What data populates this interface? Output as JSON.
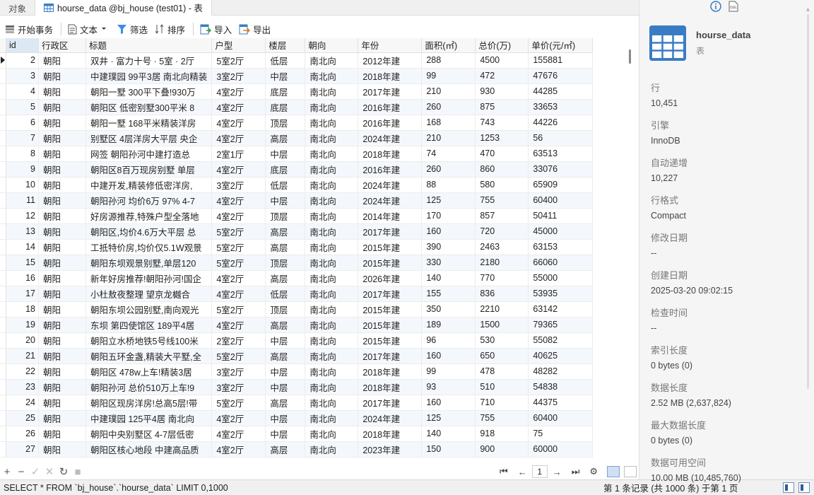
{
  "tabs": [
    {
      "label": "对象",
      "active": false
    },
    {
      "label": "hourse_data @bj_house (test01) - 表",
      "active": true
    }
  ],
  "toolbar": {
    "begin_transaction": "开始事务",
    "text": "文本",
    "filter": "筛选",
    "sort": "排序",
    "import": "导入",
    "export": "导出"
  },
  "table": {
    "columns": [
      "id",
      "行政区",
      "标题",
      "户型",
      "楼层",
      "朝向",
      "年份",
      "面积(㎡)",
      "总价(万)",
      "单价(元/㎡)"
    ],
    "rows": [
      [
        "2",
        "朝阳",
        "双井 · 富力十号 · 5室 · 2厅",
        "5室2厅",
        "低层",
        "南北向",
        "2012年建",
        "288",
        "4500",
        "155881"
      ],
      [
        "3",
        "朝阳",
        "中建璞园 99平3居 南北向精装",
        "3室2厅",
        "中层",
        "南北向",
        "2018年建",
        "99",
        "472",
        "47676"
      ],
      [
        "4",
        "朝阳",
        "朝阳一墅 300平下叠!930万",
        "4室2厅",
        "底层",
        "南北向",
        "2017年建",
        "210",
        "930",
        "44285"
      ],
      [
        "5",
        "朝阳",
        "朝阳区 低密别墅300平米 8",
        "4室2厅",
        "底层",
        "南北向",
        "2016年建",
        "260",
        "875",
        "33653"
      ],
      [
        "6",
        "朝阳",
        "朝阳一墅 168平米精装洋房",
        "4室2厅",
        "顶层",
        "南北向",
        "2016年建",
        "168",
        "743",
        "44226"
      ],
      [
        "7",
        "朝阳",
        "别墅区 4层洋房大平层 央企",
        "4室2厅",
        "高层",
        "南北向",
        "2024年建",
        "210",
        "1253",
        "56"
      ],
      [
        "8",
        "朝阳",
        "网签 朝阳孙河中建打造总",
        "2室1厅",
        "中层",
        "南北向",
        "2018年建",
        "74",
        "470",
        "63513"
      ],
      [
        "9",
        "朝阳",
        "朝阳区8百万现房别墅 单层",
        "4室2厅",
        "底层",
        "南北向",
        "2016年建",
        "260",
        "860",
        "33076"
      ],
      [
        "10",
        "朝阳",
        "中建开发,精装修低密洋房,",
        "3室2厅",
        "低层",
        "南北向",
        "2024年建",
        "88",
        "580",
        "65909"
      ],
      [
        "11",
        "朝阳",
        "朝阳孙河 均价6万 97% 4-7",
        "4室2厅",
        "中层",
        "南北向",
        "2024年建",
        "125",
        "755",
        "60400"
      ],
      [
        "12",
        "朝阳",
        "好房源推荐,特殊户型全落地",
        "4室2厅",
        "顶层",
        "南北向",
        "2014年建",
        "170",
        "857",
        "50411"
      ],
      [
        "13",
        "朝阳",
        "朝阳区,均价4.6万大平层 总",
        "5室2厅",
        "高层",
        "南北向",
        "2017年建",
        "160",
        "720",
        "45000"
      ],
      [
        "14",
        "朝阳",
        "工抵特价房,均价仅5.1W观景",
        "5室2厅",
        "高层",
        "南北向",
        "2015年建",
        "390",
        "2463",
        "63153"
      ],
      [
        "15",
        "朝阳",
        "朝阳东坝观景别墅,单层120",
        "5室2厅",
        "顶层",
        "南北向",
        "2015年建",
        "330",
        "2180",
        "66060"
      ],
      [
        "16",
        "朝阳",
        "新年好房推荐!朝阳孙河!国企",
        "4室2厅",
        "高层",
        "南北向",
        "2026年建",
        "140",
        "770",
        "55000"
      ],
      [
        "17",
        "朝阳",
        "小杜敖夜整理 望京龙樾合",
        "4室2厅",
        "低层",
        "南北向",
        "2017年建",
        "155",
        "836",
        "53935"
      ],
      [
        "18",
        "朝阳",
        "朝阳东坝公园别墅,南向观光",
        "5室2厅",
        "顶层",
        "南北向",
        "2015年建",
        "350",
        "2210",
        "63142"
      ],
      [
        "19",
        "朝阳",
        "东坝 第四使馆区 189平4居",
        "4室2厅",
        "高层",
        "南北向",
        "2015年建",
        "189",
        "1500",
        "79365"
      ],
      [
        "20",
        "朝阳",
        "朝阳立水桥地铁5号线100米",
        "2室2厅",
        "中层",
        "南北向",
        "2015年建",
        "96",
        "530",
        "55082"
      ],
      [
        "21",
        "朝阳",
        "朝阳五环金盏,精装大平墅,全",
        "5室2厅",
        "高层",
        "南北向",
        "2017年建",
        "160",
        "650",
        "40625"
      ],
      [
        "22",
        "朝阳",
        "朝阳区 478w上车!精装3居",
        "3室2厅",
        "中层",
        "南北向",
        "2018年建",
        "99",
        "478",
        "48282"
      ],
      [
        "23",
        "朝阳",
        "朝阳孙河 总价510万上车!9",
        "3室2厅",
        "中层",
        "南北向",
        "2018年建",
        "93",
        "510",
        "54838"
      ],
      [
        "24",
        "朝阳",
        "朝阳区现房洋房!总高5层!带",
        "5室2厅",
        "高层",
        "南北向",
        "2017年建",
        "160",
        "710",
        "44375"
      ],
      [
        "25",
        "朝阳",
        "中建璞园 125平4居 南北向",
        "4室2厅",
        "中层",
        "南北向",
        "2024年建",
        "125",
        "755",
        "60400"
      ],
      [
        "26",
        "朝阳",
        "朝阳中央别墅区 4-7层低密",
        "4室2厅",
        "中层",
        "南北向",
        "2018年建",
        "140",
        "918",
        "75"
      ],
      [
        "27",
        "朝阳",
        "朝阳区核心地段 中建高品质",
        "4室2厅",
        "高层",
        "南北向",
        "2023年建",
        "150",
        "900",
        "60000"
      ]
    ]
  },
  "navbar": {
    "add": "+",
    "remove": "−",
    "apply": "✓",
    "discard": "✕",
    "refresh": "↻",
    "stop": "■",
    "page": "1"
  },
  "status": {
    "sql": "SELECT * FROM `bj_house`.`hourse_data` LIMIT 0,1000",
    "page_info": "第 1 条记录 (共 1000 条) 于第 1 页"
  },
  "info_panel": {
    "name": "hourse_data",
    "type": "表",
    "properties": [
      {
        "key": "行",
        "value": "10,451"
      },
      {
        "key": "引擎",
        "value": "InnoDB"
      },
      {
        "key": "自动递增",
        "value": "10,227"
      },
      {
        "key": "行格式",
        "value": "Compact"
      },
      {
        "key": "修改日期",
        "value": "--"
      },
      {
        "key": "创建日期",
        "value": "2025-03-20 09:02:15"
      },
      {
        "key": "检查时间",
        "value": "--"
      },
      {
        "key": "索引长度",
        "value": "0 bytes (0)"
      },
      {
        "key": "数据长度",
        "value": "2.52 MB (2,637,824)"
      },
      {
        "key": "最大数据长度",
        "value": "0 bytes (0)"
      },
      {
        "key": "数据可用空间",
        "value": "10.00 MB (10,485,760)"
      }
    ]
  },
  "colors": {
    "accent": "#3a7cc4",
    "row_alt": "#f4f8fd",
    "selected_header": "#dde8f5"
  }
}
